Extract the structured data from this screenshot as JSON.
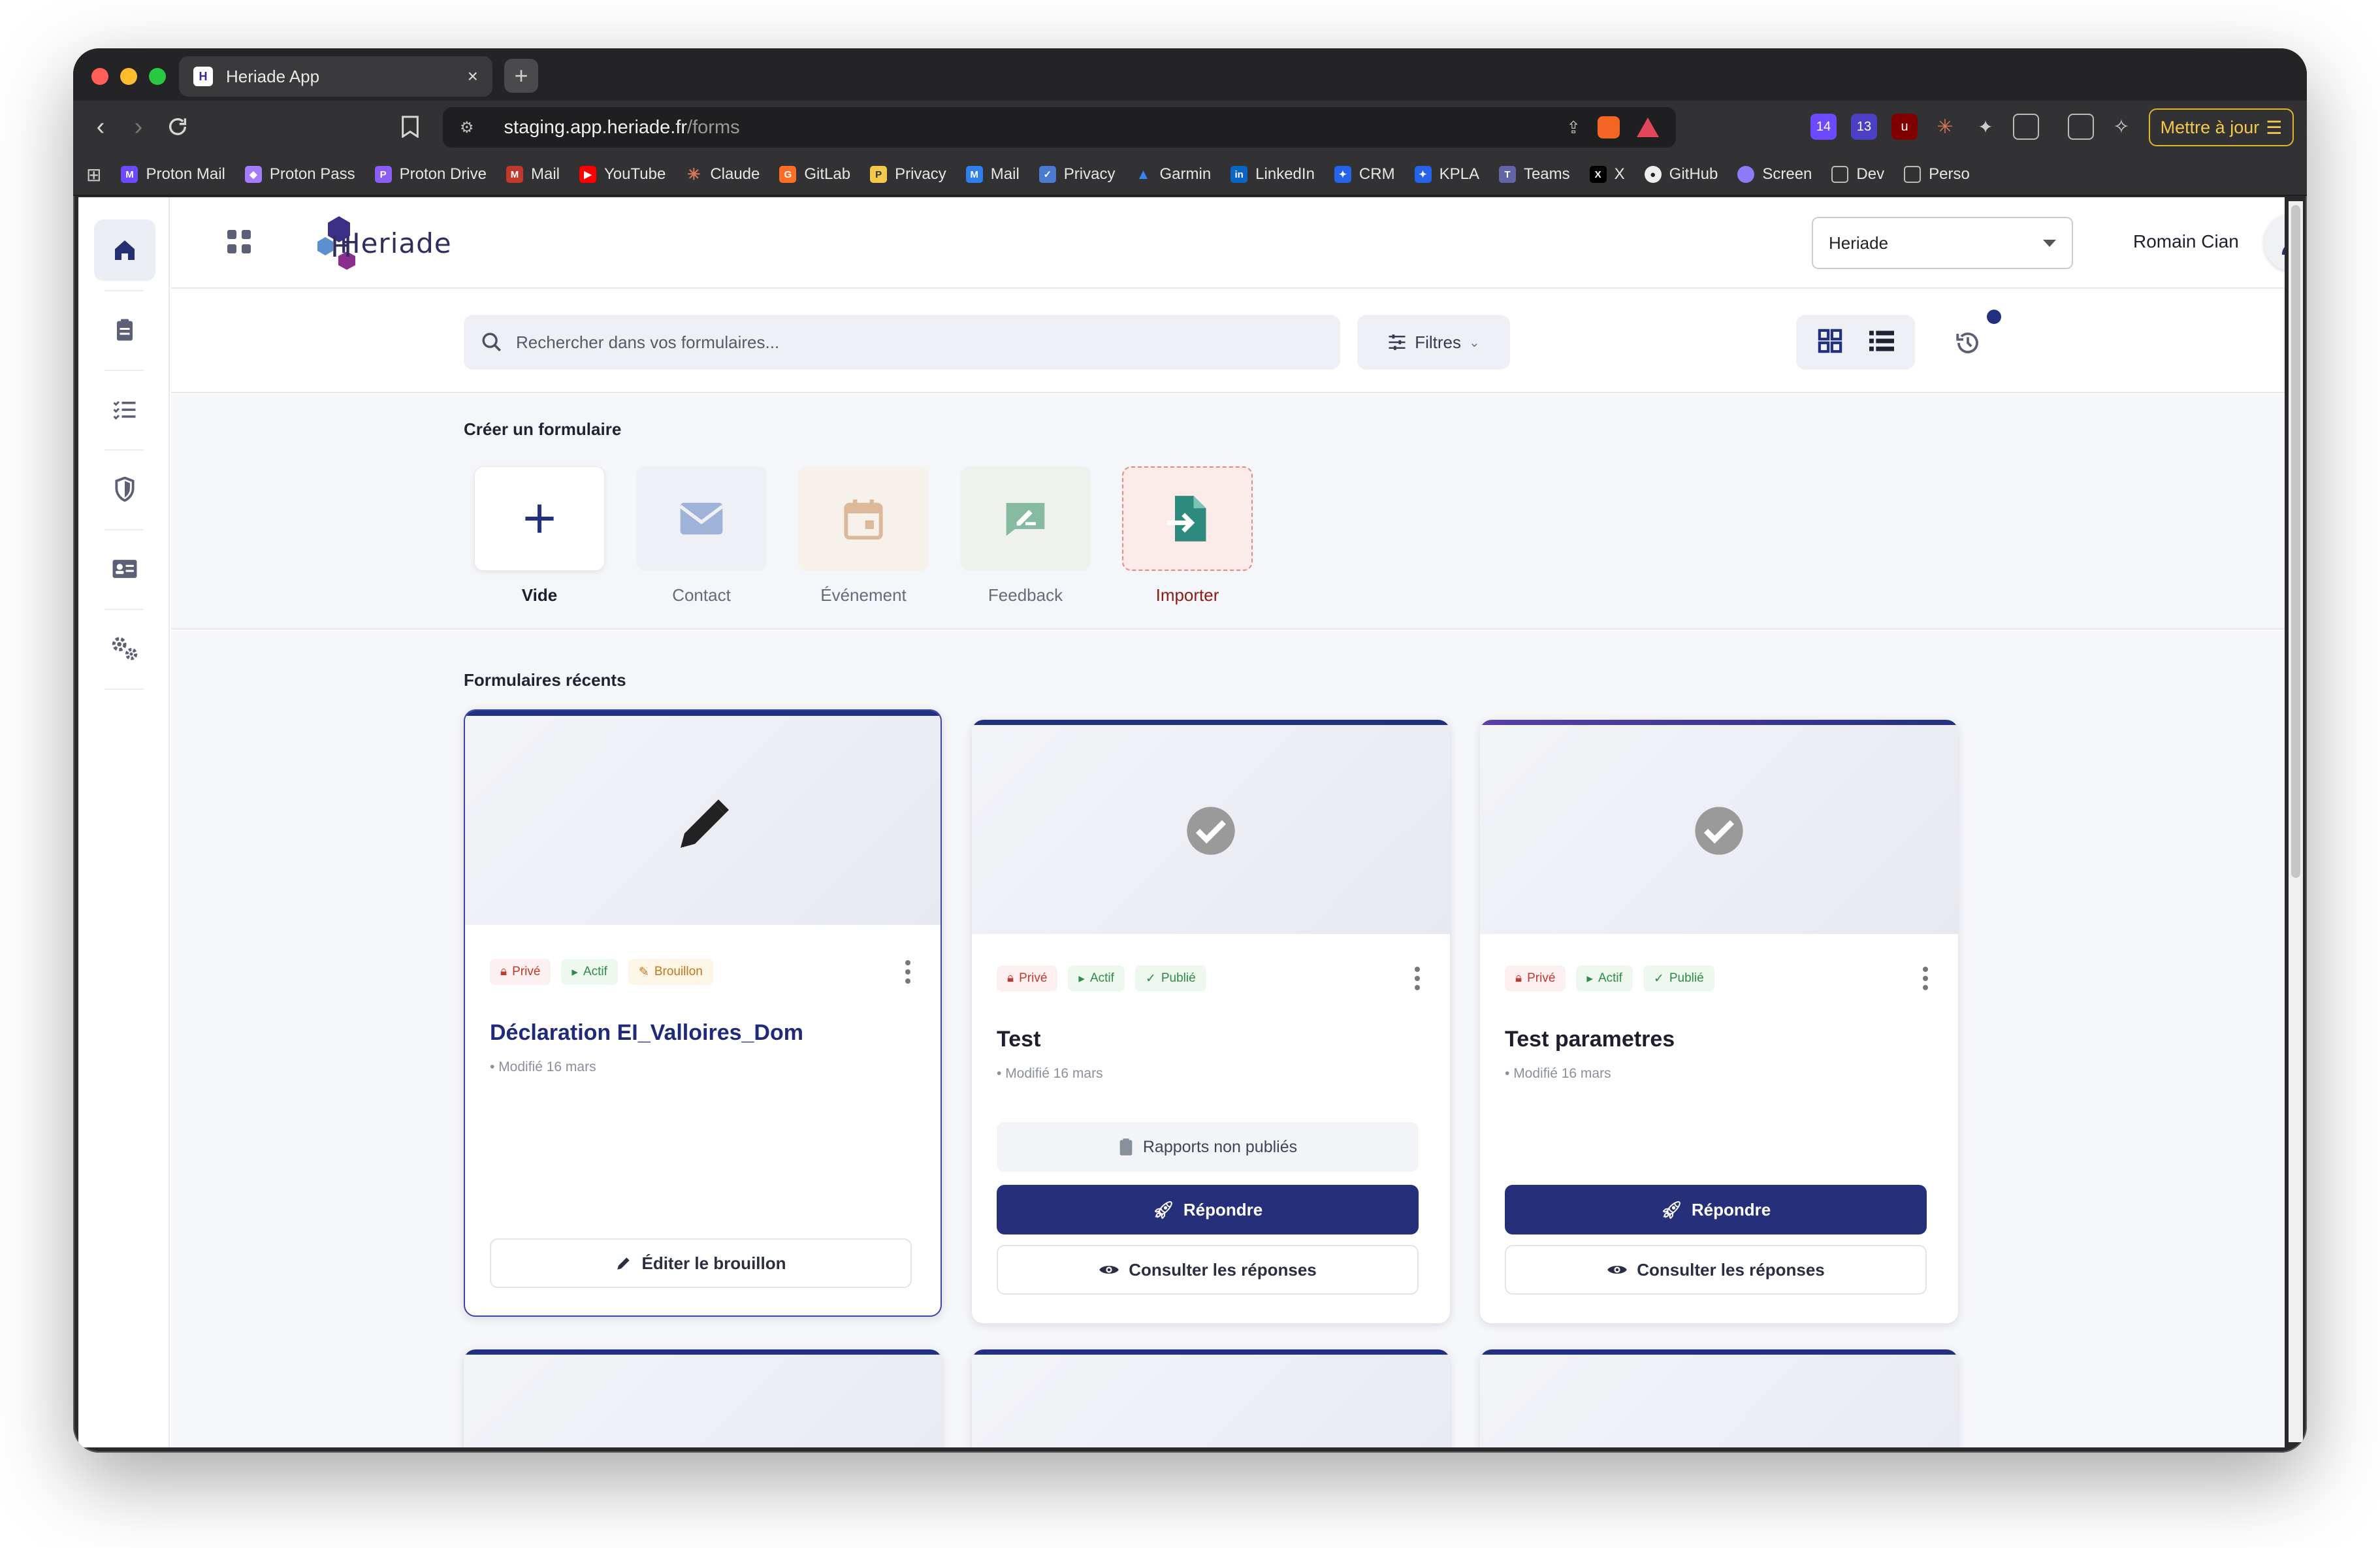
{
  "browser": {
    "tab_title": "Heriade App",
    "url_domain": "staging.app.heriade.fr",
    "url_path": "/forms",
    "update_label": "Mettre à jour",
    "extension_badges": [
      "14",
      "13"
    ],
    "bookmarks": [
      {
        "label": "Proton Mail",
        "color": "#6d4aff"
      },
      {
        "label": "Proton Pass",
        "color": "#a77bff"
      },
      {
        "label": "Proton Drive",
        "color": "#8b5cf6"
      },
      {
        "label": "Mail",
        "color": "#c0392b"
      },
      {
        "label": "YouTube",
        "color": "#ff0000"
      },
      {
        "label": "Claude",
        "color": "#d97757"
      },
      {
        "label": "GitLab",
        "color": "#fc6d26"
      },
      {
        "label": "Privacy",
        "color": "#f2c94c"
      },
      {
        "label": "Mail",
        "color": "#2f80ed"
      },
      {
        "label": "Privacy",
        "color": "#4a7bd0"
      },
      {
        "label": "Garmin",
        "color": "#3b82f6"
      },
      {
        "label": "LinkedIn",
        "color": "#0a66c2"
      },
      {
        "label": "CRM",
        "color": "#2563eb"
      },
      {
        "label": "KPLA",
        "color": "#2563eb"
      },
      {
        "label": "Teams",
        "color": "#6264a7"
      },
      {
        "label": "X",
        "color": "#000000"
      },
      {
        "label": "GitHub",
        "color": "#444444"
      },
      {
        "label": "Screen",
        "color": "#8b7cf6"
      },
      {
        "label": "Dev",
        "color": "#555555"
      },
      {
        "label": "Perso",
        "color": "#555555"
      }
    ]
  },
  "app": {
    "brand": "Heriade",
    "org_select": "Heriade",
    "user_name": "Romain Cian",
    "accent": "#233080"
  },
  "search": {
    "placeholder": "Rechercher dans vos formulaires...",
    "filters_label": "Filtres"
  },
  "create": {
    "title": "Créer un formulaire",
    "templates": [
      {
        "label": "Vide",
        "bg": "#ffffff",
        "color": "#233080"
      },
      {
        "label": "Contact",
        "bg": "#eef0f5",
        "color": "#8ea4cf"
      },
      {
        "label": "Événement",
        "bg": "#f7f0ea",
        "color": "#d9b38c"
      },
      {
        "label": "Feedback",
        "bg": "#eef1ee",
        "color": "#7fb59a"
      },
      {
        "label": "Importer",
        "bg": "#fbece9",
        "color": "#2e8a7e"
      }
    ]
  },
  "recent": {
    "title": "Formulaires récents",
    "cards": [
      {
        "badges": [
          "Privé",
          "Actif",
          "Brouillon"
        ],
        "title": "Déclaration EI_Valloires_Dom",
        "meta": "Modifié 16 mars",
        "edit_label": "Éditer le brouillon"
      },
      {
        "badges": [
          "Privé",
          "Actif",
          "Publié"
        ],
        "title": "Test",
        "meta": "Modifié 16 mars",
        "reports_label": "Rapports non publiés",
        "reply_label": "Répondre",
        "view_label": "Consulter les réponses"
      },
      {
        "badges": [
          "Privé",
          "Actif",
          "Publié"
        ],
        "title": "Test parametres",
        "meta": "Modifié 16 mars",
        "reply_label": "Répondre",
        "view_label": "Consulter les réponses"
      }
    ]
  }
}
